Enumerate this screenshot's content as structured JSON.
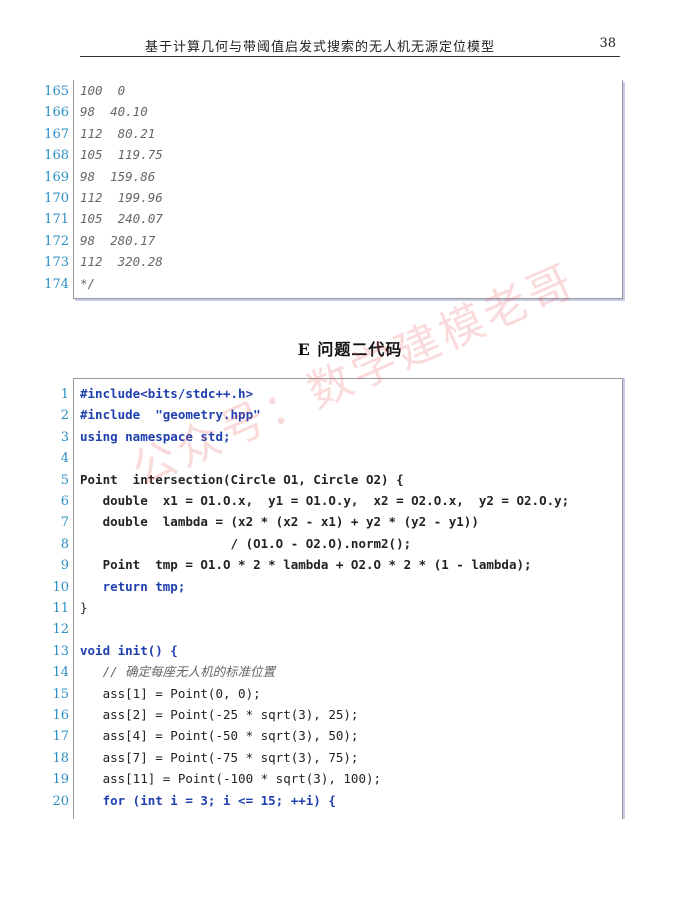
{
  "header": {
    "title": "基于计算几何与带阈值启发式搜索的无人机无源定位模型",
    "page_number": "38"
  },
  "block1": {
    "lines": [
      {
        "num": "165",
        "text": "100  0"
      },
      {
        "num": "166",
        "text": "98  40.10"
      },
      {
        "num": "167",
        "text": "112  80.21"
      },
      {
        "num": "168",
        "text": "105  119.75"
      },
      {
        "num": "169",
        "text": "98  159.86"
      },
      {
        "num": "170",
        "text": "112  199.96"
      },
      {
        "num": "171",
        "text": "105  240.07"
      },
      {
        "num": "172",
        "text": "98  280.17"
      },
      {
        "num": "173",
        "text": "112  320.28"
      },
      {
        "num": "174",
        "text": "*/"
      }
    ]
  },
  "section": {
    "title": "E   问题二代码"
  },
  "block2": {
    "lines": [
      {
        "num": "1",
        "text": "#include<bits/stdc++.h>"
      },
      {
        "num": "2",
        "text": "#include  \"geometry.hpp\""
      },
      {
        "num": "3",
        "text": "using namespace std;"
      },
      {
        "num": "4",
        "text": ""
      },
      {
        "num": "5",
        "text": "Point  intersection(Circle O1, Circle O2) {"
      },
      {
        "num": "6",
        "text": "   double  x1 = O1.O.x,  y1 = O1.O.y,  x2 = O2.O.x,  y2 = O2.O.y;"
      },
      {
        "num": "7",
        "text": "   double  lambda = (x2 * (x2 - x1) + y2 * (y2 - y1))"
      },
      {
        "num": "8",
        "text": "                    / (O1.O - O2.O).norm2();"
      },
      {
        "num": "9",
        "text": "   Point  tmp = O1.O * 2 * lambda + O2.O * 2 * (1 - lambda);"
      },
      {
        "num": "10",
        "text": "   return tmp;"
      },
      {
        "num": "11",
        "text": "}"
      },
      {
        "num": "12",
        "text": ""
      },
      {
        "num": "13",
        "text": "void init() {"
      },
      {
        "num": "14",
        "text": "   // 确定每座无人机的标准位置"
      },
      {
        "num": "15",
        "text": "   ass[1] = Point(0, 0);"
      },
      {
        "num": "16",
        "text": "   ass[2] = Point(-25 * sqrt(3), 25);"
      },
      {
        "num": "17",
        "text": "   ass[4] = Point(-50 * sqrt(3), 50);"
      },
      {
        "num": "18",
        "text": "   ass[7] = Point(-75 * sqrt(3), 75);"
      },
      {
        "num": "19",
        "text": "   ass[11] = Point(-100 * sqrt(3), 100);"
      },
      {
        "num": "20",
        "text": "   for (int i = 3; i <= 15; ++i) {"
      }
    ]
  },
  "watermark": {
    "text": "公众号：数学建模老哥"
  }
}
